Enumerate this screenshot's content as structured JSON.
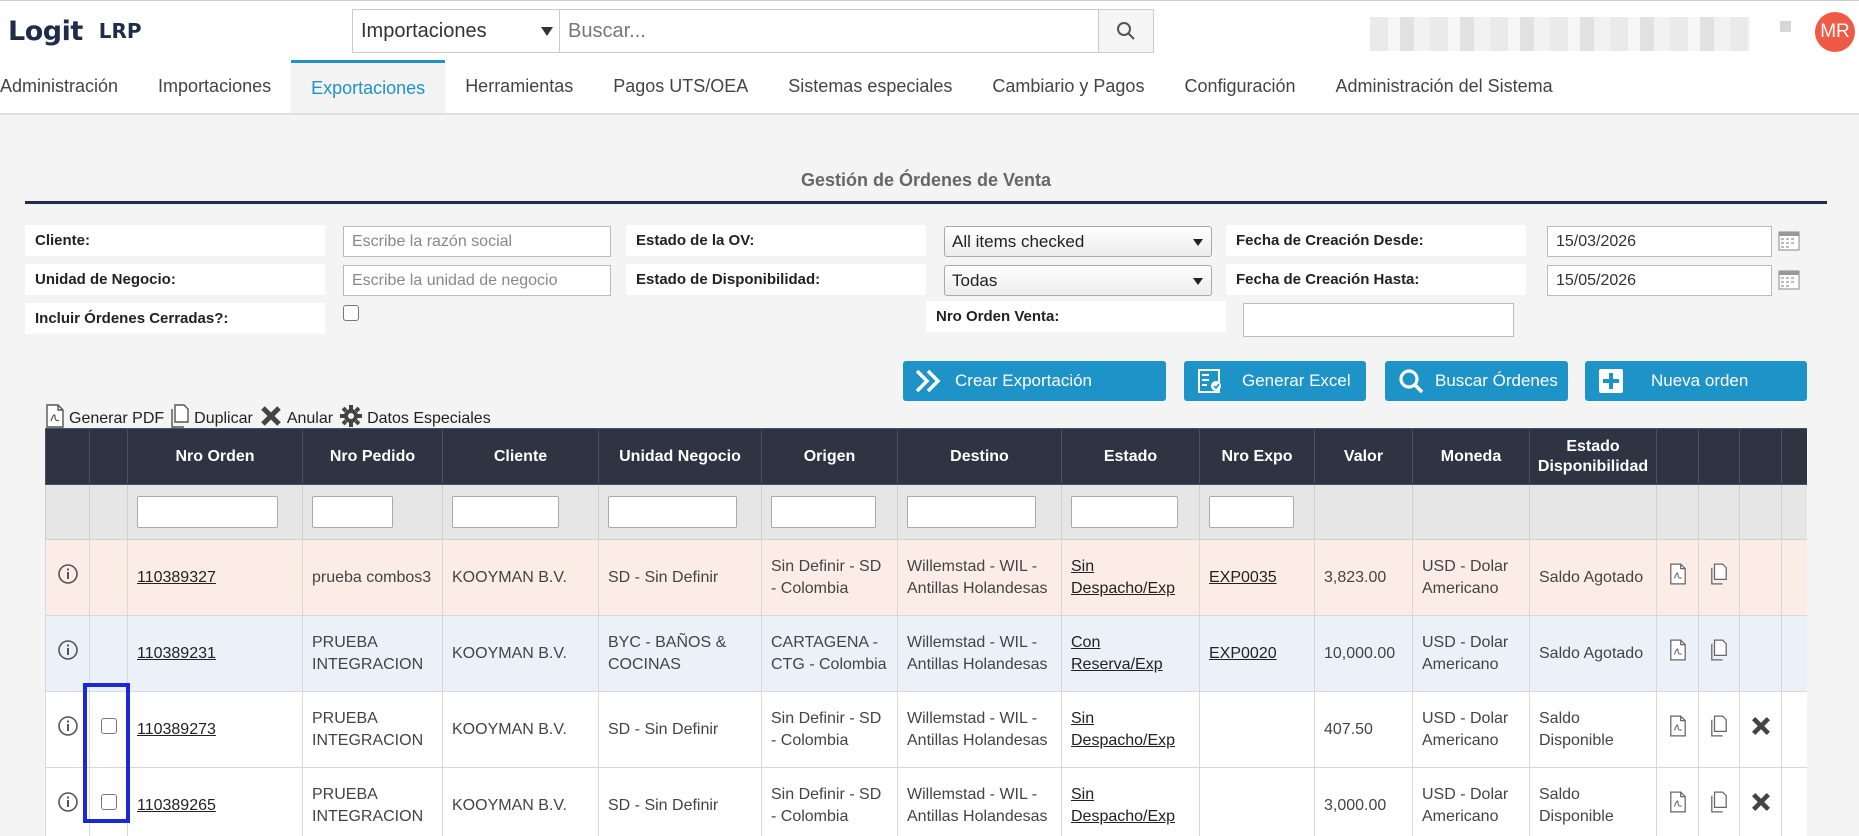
{
  "header": {
    "logo_text": "Logit",
    "logo_sub": "LRP",
    "search_scope": "Importaciones",
    "search_placeholder": "Buscar...",
    "avatar_initials": "MR"
  },
  "nav": {
    "items": [
      {
        "label": "Administración"
      },
      {
        "label": "Importaciones"
      },
      {
        "label": "Exportaciones",
        "active": true
      },
      {
        "label": "Herramientas"
      },
      {
        "label": "Pagos UTS/OEA"
      },
      {
        "label": "Sistemas especiales"
      },
      {
        "label": "Cambiario y Pagos"
      },
      {
        "label": "Configuración"
      },
      {
        "label": "Administración del Sistema"
      }
    ]
  },
  "page": {
    "title": "Gestión de Órdenes de Venta"
  },
  "filters": {
    "cliente_label": "Cliente:",
    "cliente_placeholder": "Escribe la razón social",
    "unidad_label": "Unidad de Negocio:",
    "unidad_placeholder": "Escribe la unidad de negocio",
    "incluir_label": "Incluir Órdenes Cerradas?:",
    "estado_ov_label": "Estado de la OV:",
    "estado_ov_value": "All items checked",
    "estado_disp_label": "Estado de Disponibilidad:",
    "estado_disp_value": "Todas",
    "nro_orden_label": "Nro Orden Venta:",
    "fecha_desde_label": "Fecha de Creación Desde:",
    "fecha_desde_value": "15/03/2026",
    "fecha_hasta_label": "Fecha de Creación Hasta:",
    "fecha_hasta_value": "15/05/2026"
  },
  "actions": {
    "crear": "Crear Exportación",
    "excel": "Generar Excel",
    "buscar": "Buscar Órdenes",
    "nueva": "Nueva orden"
  },
  "toolbar": {
    "pdf": "Generar PDF",
    "duplicar": "Duplicar",
    "anular": "Anular",
    "datos": "Datos Especiales"
  },
  "table": {
    "columns": [
      "Nro Orden",
      "Nro Pedido",
      "Cliente",
      "Unidad Negocio",
      "Origen",
      "Destino",
      "Estado",
      "Nro Expo",
      "Valor",
      "Moneda",
      "Estado Disponibilidad"
    ],
    "rows": [
      {
        "orden": "110389327",
        "pedido": "prueba combos3",
        "cliente": "KOOYMAN B.V.",
        "unidad": "SD - Sin Definir",
        "origen": "Sin Definir - SD - Colombia",
        "destino": "Willemstad - WIL - Antillas Holandesas",
        "estado": "Sin Despacho/Exp",
        "expo": "EXP0035",
        "valor": "3,823.00",
        "moneda": "USD - Dolar Americano",
        "disponibilidad": "Saldo Agotado"
      },
      {
        "orden": "110389231",
        "pedido": "PRUEBA INTEGRACION",
        "cliente": "KOOYMAN B.V.",
        "unidad": "BYC - BAÑOS & COCINAS",
        "origen": "CARTAGENA - CTG - Colombia",
        "destino": "Willemstad - WIL - Antillas Holandesas",
        "estado": "Con Reserva/Exp",
        "expo": "EXP0020",
        "valor": "10,000.00",
        "moneda": "USD - Dolar Americano",
        "disponibilidad": "Saldo Agotado"
      },
      {
        "orden": "110389273",
        "pedido": "PRUEBA INTEGRACION",
        "cliente": "KOOYMAN B.V.",
        "unidad": "SD - Sin Definir",
        "origen": "Sin Definir - SD - Colombia",
        "destino": "Willemstad - WIL - Antillas Holandesas",
        "estado": "Sin Despacho/Exp",
        "expo": "",
        "valor": "407.50",
        "moneda": "USD - Dolar Americano",
        "disponibilidad": "Saldo Disponible"
      },
      {
        "orden": "110389265",
        "pedido": "PRUEBA INTEGRACION",
        "cliente": "KOOYMAN B.V.",
        "unidad": "SD - Sin Definir",
        "origen": "Sin Definir - SD - Colombia",
        "destino": "Willemstad - WIL - Antillas Holandesas",
        "estado": "Sin Despacho/Exp",
        "expo": "",
        "valor": "3,000.00",
        "moneda": "USD - Dolar Americano",
        "disponibilidad": "Saldo Disponible"
      }
    ]
  },
  "colors": {
    "accent": "#1e93c7",
    "header_dark": "#2f3442",
    "row_peach": "#fbede6",
    "row_blue": "#eaf1f8",
    "highlight": "#1a28d6",
    "avatar": "#ee5a45"
  }
}
